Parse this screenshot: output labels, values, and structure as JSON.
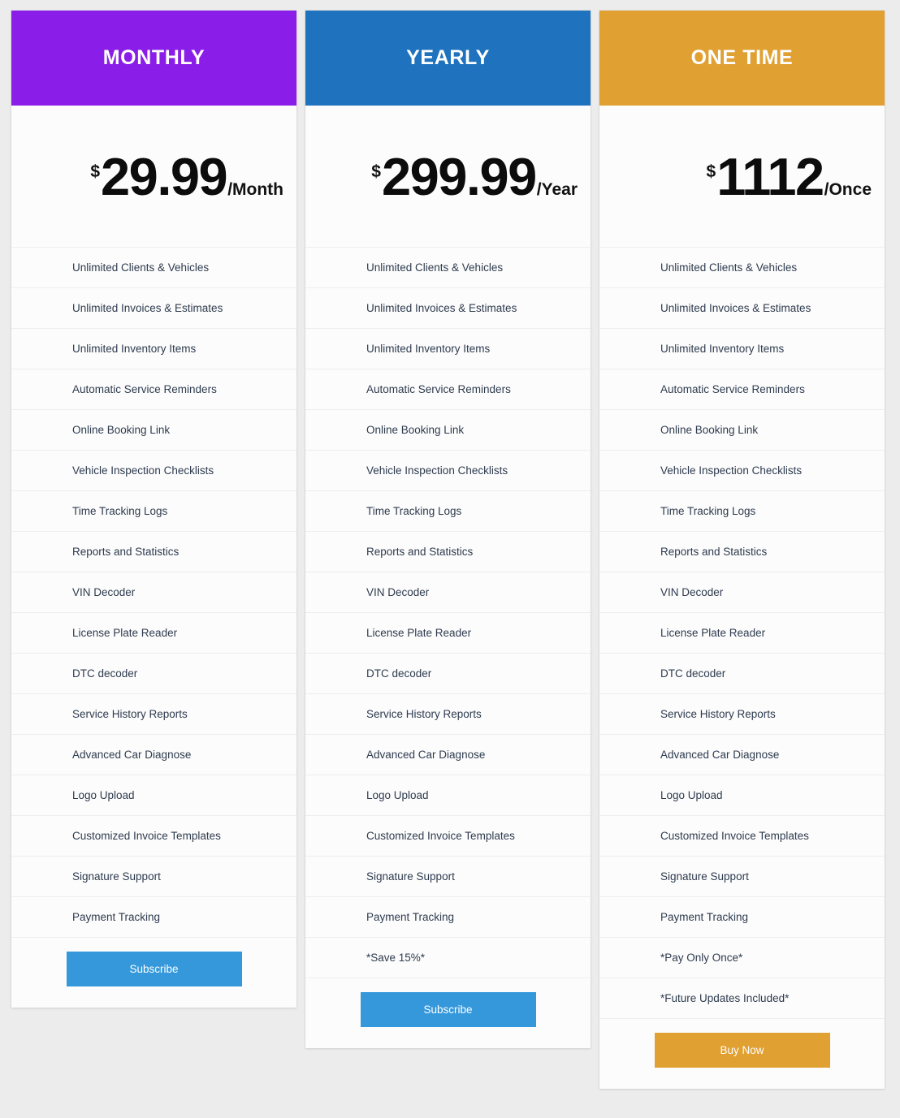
{
  "page": {
    "background_color": "#ececec",
    "card_background": "#fcfcfc",
    "text_color": "#2e3b4e",
    "divider_color": "#eeeeee"
  },
  "plans": [
    {
      "id": "monthly",
      "title": "MONTHLY",
      "header_color": "#8A1EE8",
      "currency": "$",
      "amount": "29.99",
      "period": "/Month",
      "features": [
        "Unlimited Clients & Vehicles",
        "Unlimited Invoices & Estimates",
        "Unlimited Inventory Items",
        "Automatic Service Reminders",
        "Online Booking Link",
        "Vehicle Inspection Checklists",
        "Time Tracking Logs",
        "Reports and Statistics",
        "VIN Decoder",
        "License Plate Reader",
        "DTC decoder",
        "Service History Reports",
        "Advanced Car Diagnose",
        "Logo Upload",
        "Customized Invoice Templates",
        "Signature Support",
        "Payment Tracking"
      ],
      "cta_label": "Subscribe",
      "cta_color": "#3498DB"
    },
    {
      "id": "yearly",
      "title": "YEARLY",
      "header_color": "#1F72BD",
      "currency": "$",
      "amount": "299.99",
      "period": "/Year",
      "features": [
        "Unlimited Clients & Vehicles",
        "Unlimited Invoices & Estimates",
        "Unlimited Inventory Items",
        "Automatic Service Reminders",
        "Online Booking Link",
        "Vehicle Inspection Checklists",
        "Time Tracking Logs",
        "Reports and Statistics",
        "VIN Decoder",
        "License Plate Reader",
        "DTC decoder",
        "Service History Reports",
        "Advanced Car Diagnose",
        "Logo Upload",
        "Customized Invoice Templates",
        "Signature Support",
        "Payment Tracking",
        "*Save 15%*"
      ],
      "cta_label": "Subscribe",
      "cta_color": "#3498DB"
    },
    {
      "id": "one-time",
      "title": "ONE TIME",
      "header_color": "#E0A032",
      "currency": "$",
      "amount": "1112",
      "period": "/Once",
      "features": [
        "Unlimited Clients & Vehicles",
        "Unlimited Invoices & Estimates",
        "Unlimited Inventory Items",
        "Automatic Service Reminders",
        "Online Booking Link",
        "Vehicle Inspection Checklists",
        "Time Tracking Logs",
        "Reports and Statistics",
        "VIN Decoder",
        "License Plate Reader",
        "DTC decoder",
        "Service History Reports",
        "Advanced Car Diagnose",
        "Logo Upload",
        "Customized Invoice Templates",
        "Signature Support",
        "Payment Tracking",
        "*Pay Only Once*",
        "*Future Updates Included*"
      ],
      "cta_label": "Buy Now",
      "cta_color": "#E0A032"
    }
  ]
}
